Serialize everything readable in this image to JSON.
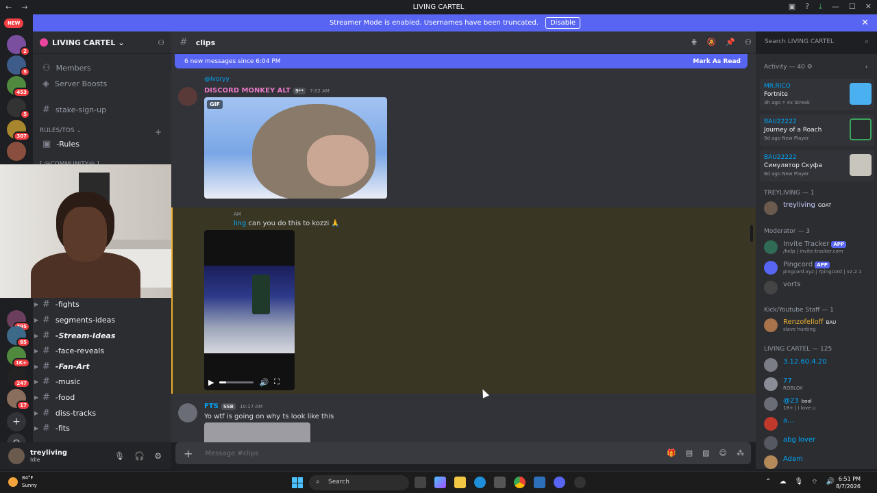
{
  "window": {
    "title": "LIVING CARTEL"
  },
  "banner": {
    "text": "Streamer Mode is enabled. Usernames have been truncated.",
    "button": "Disable"
  },
  "guilds": {
    "new_label": "NEW",
    "badges": [
      "2",
      "5",
      "453",
      "5",
      "307",
      "395",
      "85",
      "1K+",
      "247",
      "17"
    ]
  },
  "server": {
    "name": "LIVING CARTEL",
    "items": [
      {
        "label": "Members",
        "icon": "members-icon"
      },
      {
        "label": "Server Boosts",
        "icon": "boost-icon"
      }
    ],
    "channels_top": [
      "stake-sign-up"
    ],
    "category1": "RULES/TOS",
    "rules_channel": "-Rules",
    "category2": "[ @COMMUNITY@ ]",
    "channels_bottom": [
      "-fights",
      "segments-ideas",
      "-Stream-Ideas",
      "-face-reveals",
      "-Fan-Art",
      "-music",
      "-food",
      "diss-tracks",
      "-fits"
    ]
  },
  "user": {
    "name": "treyliving",
    "status": "Idle"
  },
  "chat": {
    "channel": "clips",
    "new_messages": "6 new messages since 6:04 PM",
    "mark_as_read": "Mark As Read",
    "search_placeholder": "Search LIVING CARTEL",
    "messages": [
      {
        "reply_to": "@Ivoryy",
        "author": "DISCORD MONKEY ALT",
        "tag": "9**",
        "time": "7:02 AM",
        "gif_label": "GIF"
      },
      {
        "time": "AM",
        "author_frag": "ling",
        "text": "can you do this to kozzi 🙏"
      },
      {
        "author": "FTS",
        "tag": "SSB",
        "time": "10:17 AM",
        "text": "Yo wtf is going on why ts look like this"
      }
    ],
    "composer_placeholder": "Message #",
    "composer_channel": "clips"
  },
  "members": {
    "activity_header": "Activity — 40",
    "activities": [
      {
        "name": "MR.RICO",
        "game": "Fortnite",
        "meta": "3h ago  ⚡ 4x Streak",
        "color": "#4ab0f0"
      },
      {
        "name": "BAU22222",
        "game": "Journey of a Roach",
        "meta": "9d ago  New Player",
        "color": "#2a2c30"
      },
      {
        "name": "BAU22222",
        "game": "Симулятор Скуфа",
        "meta": "8d ago  New Player",
        "color": "#c8c5bd"
      }
    ],
    "sections": [
      {
        "header": "TREYLIVING — 1",
        "members": [
          {
            "name": "treyliving",
            "role": "GOAT",
            "color": "#c9cdfb"
          }
        ]
      },
      {
        "header": "Moderator — 3",
        "members": [
          {
            "name": "Invite Tracker",
            "sub": "/help | invite-tracker.com",
            "app": "APP",
            "color": "#949ba4"
          },
          {
            "name": "Pingcord",
            "sub": "pingcord.xyz | ?pingcord | v2.2.1",
            "app": "APP",
            "color": "#949ba4"
          },
          {
            "name": "vorts",
            "color": "#949ba4"
          }
        ]
      },
      {
        "header": "Kick/Youtube Staff — 1",
        "members": [
          {
            "name": "Renzofelloff",
            "sub": "slave hunting",
            "role": "BAU",
            "color": "#f0b232"
          }
        ]
      },
      {
        "header": "LIVING CARTEL — 125",
        "members": [
          {
            "name": "3.12.60.4.20",
            "color": "#00a8fc"
          },
          {
            "name": "77",
            "sub": "ROBLOX",
            "color": "#00a8fc"
          },
          {
            "name": "@23",
            "sub": "18+ | i love u",
            "role": "bool",
            "color": "#00a8fc"
          },
          {
            "name": "a...",
            "color": "#00a8fc"
          },
          {
            "name": "abg lover",
            "color": "#00a8fc"
          },
          {
            "name": "Adam",
            "color": "#00a8fc"
          }
        ]
      }
    ]
  },
  "taskbar": {
    "weather_temp": "84°F",
    "weather_desc": "Sunny",
    "search": "Search",
    "time": "6:51 PM",
    "date": "8/7/2026"
  }
}
